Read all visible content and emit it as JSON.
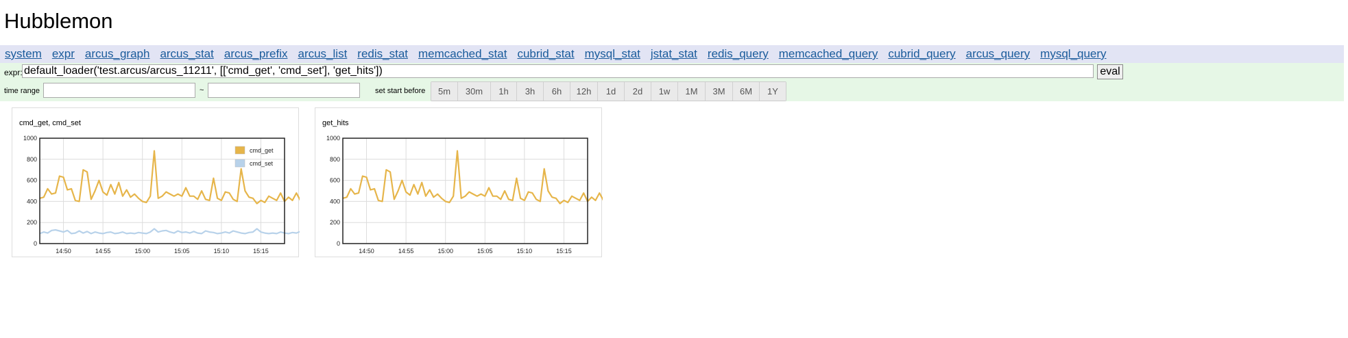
{
  "app": {
    "title": "Hubblemon"
  },
  "nav": {
    "links": [
      "system",
      "expr",
      "arcus_graph",
      "arcus_stat",
      "arcus_prefix",
      "arcus_list",
      "redis_stat",
      "memcached_stat",
      "cubrid_stat",
      "mysql_stat",
      "jstat_stat",
      "redis_query",
      "memcached_query",
      "cubrid_query",
      "arcus_query",
      "mysql_query"
    ]
  },
  "expr": {
    "label": "expr:",
    "value": "default_loader('test.arcus/arcus_11211', [['cmd_get', 'cmd_set'], 'get_hits'])",
    "eval_label": "eval"
  },
  "time_range": {
    "label": "time range",
    "separator": "~",
    "start_value": "",
    "end_value": "",
    "set_start_label": "set start before",
    "presets": [
      "5m",
      "30m",
      "1h",
      "3h",
      "6h",
      "12h",
      "1d",
      "2d",
      "1w",
      "1M",
      "3M",
      "6M",
      "1Y"
    ]
  },
  "charts": [
    {
      "title": "cmd_get, cmd_set"
    },
    {
      "title": "get_hits"
    }
  ],
  "chart_data": [
    {
      "type": "line",
      "title": "cmd_get, cmd_set",
      "legend_position": "top-right",
      "grid": true,
      "ylim": [
        0,
        1000
      ],
      "yticks": [
        "0",
        "200",
        "400",
        "600",
        "800",
        "1000"
      ],
      "xlim": [
        "14:47",
        "15:18"
      ],
      "xticks": [
        "14:50",
        "14:55",
        "15:00",
        "15:05",
        "15:10",
        "15:15"
      ],
      "x_minutes_start": "14:47",
      "x_step_minutes": 0.5,
      "series": [
        {
          "name": "cmd_get",
          "color": "#e6b54a",
          "values": [
            430,
            440,
            520,
            470,
            480,
            640,
            630,
            510,
            520,
            410,
            400,
            700,
            680,
            420,
            500,
            600,
            490,
            460,
            560,
            470,
            580,
            450,
            510,
            440,
            470,
            430,
            400,
            390,
            450,
            880,
            430,
            450,
            490,
            470,
            450,
            470,
            450,
            530,
            450,
            450,
            420,
            500,
            420,
            410,
            620,
            430,
            410,
            490,
            480,
            420,
            400,
            710,
            500,
            440,
            430,
            380,
            410,
            390,
            450,
            430,
            410,
            480,
            400,
            440,
            410,
            480,
            410,
            400,
            560,
            450,
            440,
            400,
            410,
            440,
            560,
            440,
            400,
            380,
            450
          ]
        },
        {
          "name": "cmd_set",
          "color": "#b8d2ea",
          "values": [
            95,
            110,
            100,
            125,
            130,
            120,
            110,
            125,
            95,
            100,
            120,
            100,
            115,
            95,
            110,
            100,
            95,
            105,
            110,
            95,
            100,
            110,
            95,
            100,
            95,
            105,
            100,
            95,
            110,
            140,
            110,
            120,
            125,
            110,
            100,
            120,
            105,
            110,
            100,
            115,
            100,
            95,
            120,
            110,
            105,
            95,
            100,
            110,
            100,
            120,
            110,
            100,
            95,
            105,
            110,
            140,
            110,
            100,
            95,
            100,
            95,
            110,
            100,
            95,
            105,
            100,
            115,
            100,
            120,
            100,
            95,
            115,
            110,
            100,
            95,
            105,
            110,
            95,
            100
          ]
        }
      ]
    },
    {
      "type": "line",
      "title": "get_hits",
      "grid": true,
      "ylim": [
        0,
        1000
      ],
      "yticks": [
        "0",
        "200",
        "400",
        "600",
        "800",
        "1000"
      ],
      "xlim": [
        "14:47",
        "15:18"
      ],
      "xticks": [
        "14:50",
        "14:55",
        "15:00",
        "15:05",
        "15:10",
        "15:15"
      ],
      "x_minutes_start": "14:47",
      "x_step_minutes": 0.5,
      "series": [
        {
          "name": "get_hits",
          "color": "#e6b54a",
          "values": [
            430,
            440,
            520,
            470,
            480,
            640,
            630,
            510,
            520,
            410,
            400,
            700,
            680,
            420,
            500,
            600,
            490,
            460,
            560,
            470,
            580,
            450,
            510,
            440,
            470,
            430,
            400,
            390,
            450,
            880,
            430,
            450,
            490,
            470,
            450,
            470,
            450,
            530,
            450,
            450,
            420,
            500,
            420,
            410,
            620,
            430,
            410,
            490,
            480,
            420,
            400,
            710,
            500,
            440,
            430,
            380,
            410,
            390,
            450,
            430,
            410,
            480,
            400,
            440,
            410,
            480,
            410,
            400,
            560,
            450,
            440,
            400,
            410,
            440,
            560,
            440,
            400,
            380,
            450
          ]
        }
      ]
    }
  ]
}
